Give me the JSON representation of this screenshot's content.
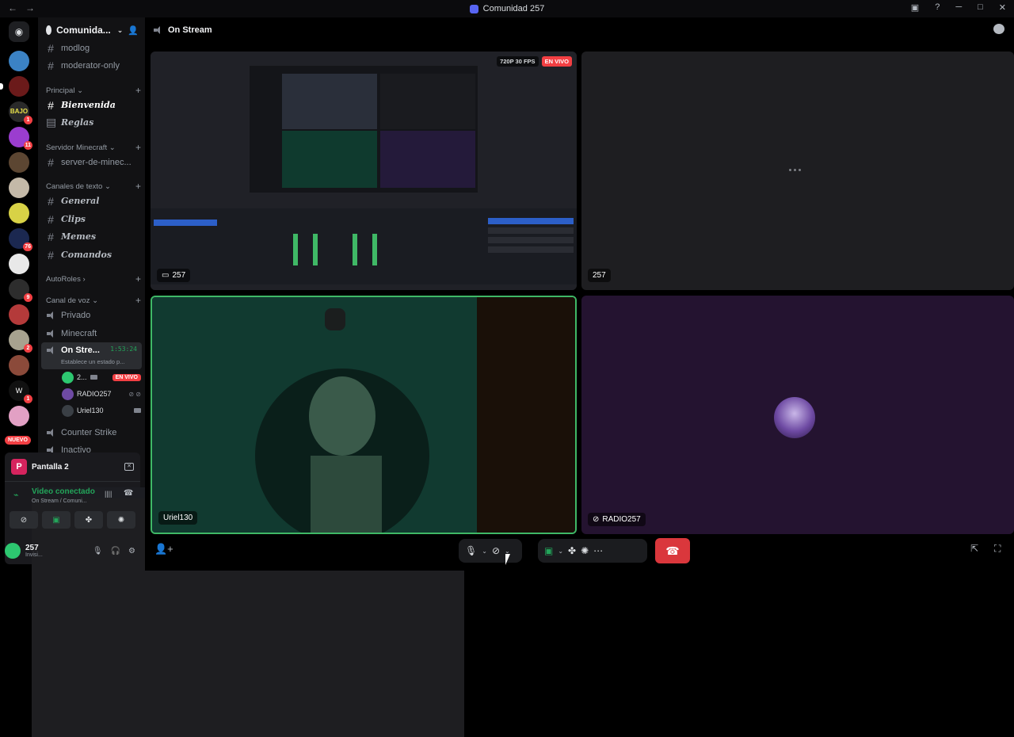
{
  "window": {
    "title": "Comunidad 257"
  },
  "server": {
    "name": "Comunida..."
  },
  "channels_top": [
    {
      "label": "modlog"
    },
    {
      "label": "moderator-only"
    }
  ],
  "categories": {
    "principal": "Principal",
    "minecraft": "Servidor Minecraft",
    "texto": "Canales de texto",
    "autoroles": "AutoRoles",
    "voz": "Canal de voz"
  },
  "principal_channels": [
    {
      "label": "Bienvenida"
    },
    {
      "label": "Reglas"
    }
  ],
  "minecraft_channels": [
    {
      "label": "server-de-minec..."
    }
  ],
  "text_channels": [
    {
      "label": "General"
    },
    {
      "label": "Clips"
    },
    {
      "label": "Memes"
    },
    {
      "label": "Comandos"
    }
  ],
  "voice_channels": {
    "privado": "Privado",
    "minecraft": "Minecraft",
    "on_stream": "On Stre...",
    "timer": "1:53:24",
    "status": "Establece un estado p...",
    "counter": "Counter Strike",
    "inactivo": "Inactivo"
  },
  "voice_users": [
    {
      "name": "2...",
      "badge": "EN VIVO"
    },
    {
      "name": "RADIO257"
    },
    {
      "name": "Uriel130"
    }
  ],
  "guild_badges": [
    "1",
    "11",
    "76",
    "9",
    "2",
    "1"
  ],
  "nuevo": "NUEVO",
  "panel": {
    "screen": "Pantalla 2",
    "logo": "P",
    "connected": "Video conectado",
    "location": "On Stream / Comuni..."
  },
  "user": {
    "name": "257",
    "status": "Invisi..."
  },
  "stage": {
    "title": "On Stream"
  },
  "tiles": [
    {
      "name": "257",
      "quality": "720P 30 FPS",
      "live": "EN VIVO"
    },
    {
      "name": "257"
    },
    {
      "name": "Uriel130"
    },
    {
      "name": "RADIO257"
    }
  ],
  "colors": {
    "accent": "#5865f2",
    "live": "#f23f43",
    "connected": "#23a55a",
    "hangup": "#da373c"
  }
}
